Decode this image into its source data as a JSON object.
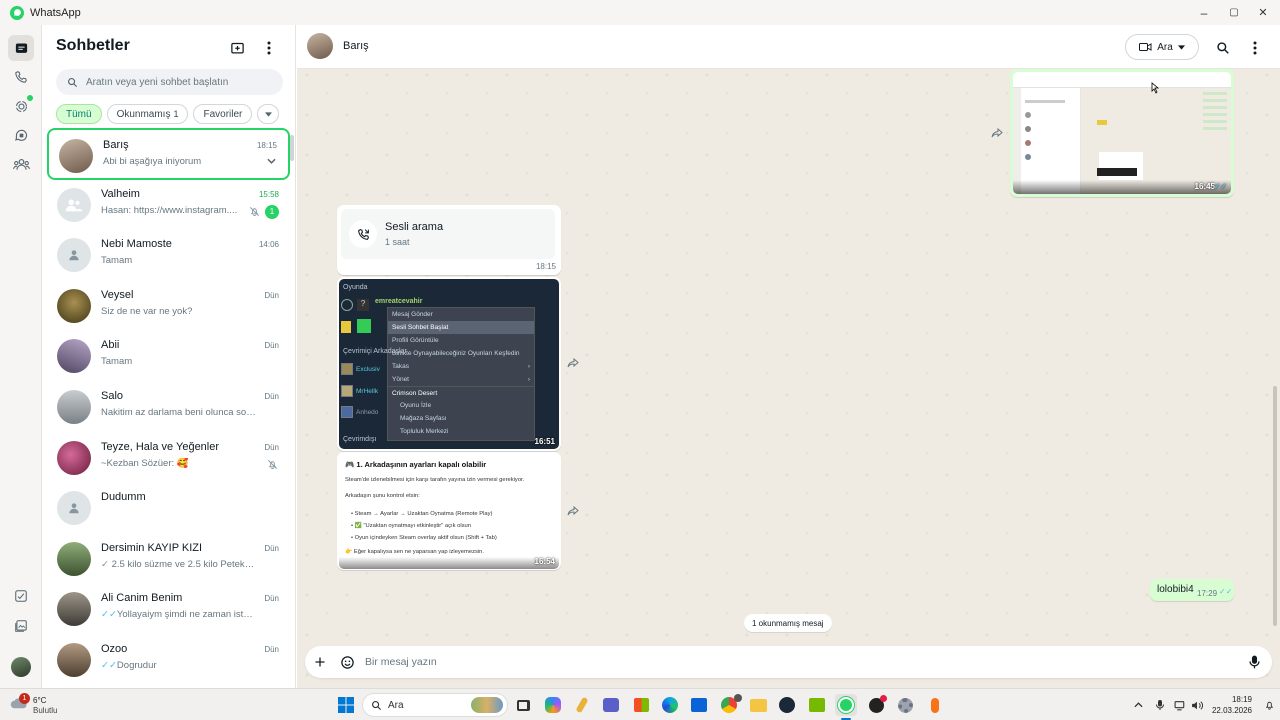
{
  "window": {
    "app_name": "WhatsApp",
    "minimize": "–",
    "maximize": "▢",
    "close": "✕"
  },
  "sidebar": {
    "title": "Sohbetler",
    "search_placeholder": "Aratın veya yeni sohbet başlatın",
    "filters": [
      {
        "label": "Tümü",
        "count": ""
      },
      {
        "label": "Okunmamış",
        "count": "1"
      },
      {
        "label": "Favoriler",
        "count": ""
      }
    ],
    "chats": [
      {
        "name": "Barış",
        "time": "18:15",
        "preview": "Abi bi aşağıya iniyorum",
        "selected": true,
        "avatar_color": "#8c7b6b"
      },
      {
        "name": "Valheim",
        "time": "15:58",
        "preview": "Hasan: https://www.instagram....",
        "unread": "1",
        "muted": true,
        "group": true
      },
      {
        "name": "Nebi Mamoste",
        "time": "14:06",
        "preview": "Tamam",
        "default_avatar": true
      },
      {
        "name": "Veysel",
        "time": "Dün",
        "preview": "Siz de ne var ne yok?",
        "avatar_color": "#6b5a2e"
      },
      {
        "name": "Abii",
        "time": "Dün",
        "preview": "Tamam",
        "avatar_color": "#7a6a8a"
      },
      {
        "name": "Salo",
        "time": "Dün",
        "preview": "Nakitim az darlama beni olunca soyliy...",
        "avatar_color": "#9aa0a4"
      },
      {
        "name": "Teyze, Hala ve Yeğenler",
        "time": "Dün",
        "preview": "~Kezban Sözüer: 🥰",
        "muted": true,
        "avatar_color": "#a03a6a"
      },
      {
        "name": "Dudumm",
        "time": "",
        "preview": "",
        "default_avatar": true
      },
      {
        "name": "Dersimin KAYIP KIZI",
        "time": "Dün",
        "preview": "2.5 kilo süzme ve 2.5 kilo Petek bir ...",
        "tick": "✓",
        "avatar_color": "#5f7a4a"
      },
      {
        "name": "Ali Canim Benim",
        "time": "Dün",
        "preview": "Yollayaiym şimdi ne zaman isterse...",
        "tick": "✓✓",
        "avatar_color": "#6e6a62"
      },
      {
        "name": "Ozoo",
        "time": "Dün",
        "preview": "Dogrudur",
        "tick": "✓✓",
        "avatar_color": "#7d6d5d"
      }
    ]
  },
  "chat": {
    "contact_name": "Barış",
    "call_button_label": "Ara",
    "call_card": {
      "title": "Sesli arama",
      "subtitle": "1 saat",
      "time": "18:15"
    },
    "steam_image": {
      "time": "16:51",
      "section_top": "Oyunda",
      "friend_name": "emreatcevahir",
      "section_online": "Çevrimiçi Arkadaşlar",
      "friend2": "Exclusiv",
      "friend3": "MrHellk",
      "friend4": "Anhedo",
      "section_bottom": "Çevrimdışı",
      "menu_items": [
        "Mesaj Gönder",
        "Sesli Sohbet Başlat",
        "Profili Görüntüle",
        "Birlikte Oynayabileceğiniz Oyunları Keşfedin",
        "Takas",
        "Yönet",
        "Crimson Desert",
        "Oyunu İzle",
        "Mağaza Sayfası",
        "Topluluk Merkezi"
      ]
    },
    "doc_image": {
      "time": "16:54",
      "heading": "🎮 1. Arkadaşının ayarları kapalı olabilir",
      "line1": "Steam'de izlenebilmesi için karşı tarafın yayına izin vermesi gerekiyor.",
      "line2": "Arkadaşın şunu kontrol etsin:",
      "bullet1": "• Steam → Ayarlar → Uzaktan Oynatma (Remote Play)",
      "bullet2": "• ✅ \"Uzaktan oynatmayı etkinleştir\" açık olsun",
      "bullet3": "• Oyun içindeyken Steam overlay aktif olsun (Shift + Tab)",
      "footer": "👉 Eğer kapalıysa sen ne yaparsan yap izleyemezsin."
    },
    "screenshot_image": {
      "time": "16:45"
    },
    "outgoing_message": {
      "text": "lolobibi4",
      "time": "17:29",
      "tick": "✓✓"
    },
    "unread_divider": "1 okunmamış mesaj",
    "composer_placeholder": "Bir mesaj yazın"
  },
  "taskbar": {
    "weather_temp": "6°C",
    "weather_cond": "Bulutlu",
    "weather_badge": "1",
    "search_label": "Ara",
    "clock_time": "18:19",
    "clock_date": "22.03.2026"
  },
  "colors": {
    "accent": "#25d366",
    "chat_bg": "#efeae2",
    "outgoing": "#d9fdd3",
    "read_tick": "#53bdeb"
  },
  "icons": [
    "whatsapp-logo-icon",
    "chats-icon",
    "calls-icon",
    "status-icon",
    "channels-icon",
    "communities-icon",
    "starred-icon",
    "media-icon",
    "new-chat-icon",
    "menu-icon",
    "search-icon",
    "video-call-icon",
    "forward-icon",
    "plus-icon",
    "emoji-icon",
    "mic-icon",
    "mute-icon",
    "chevron-down-icon"
  ]
}
